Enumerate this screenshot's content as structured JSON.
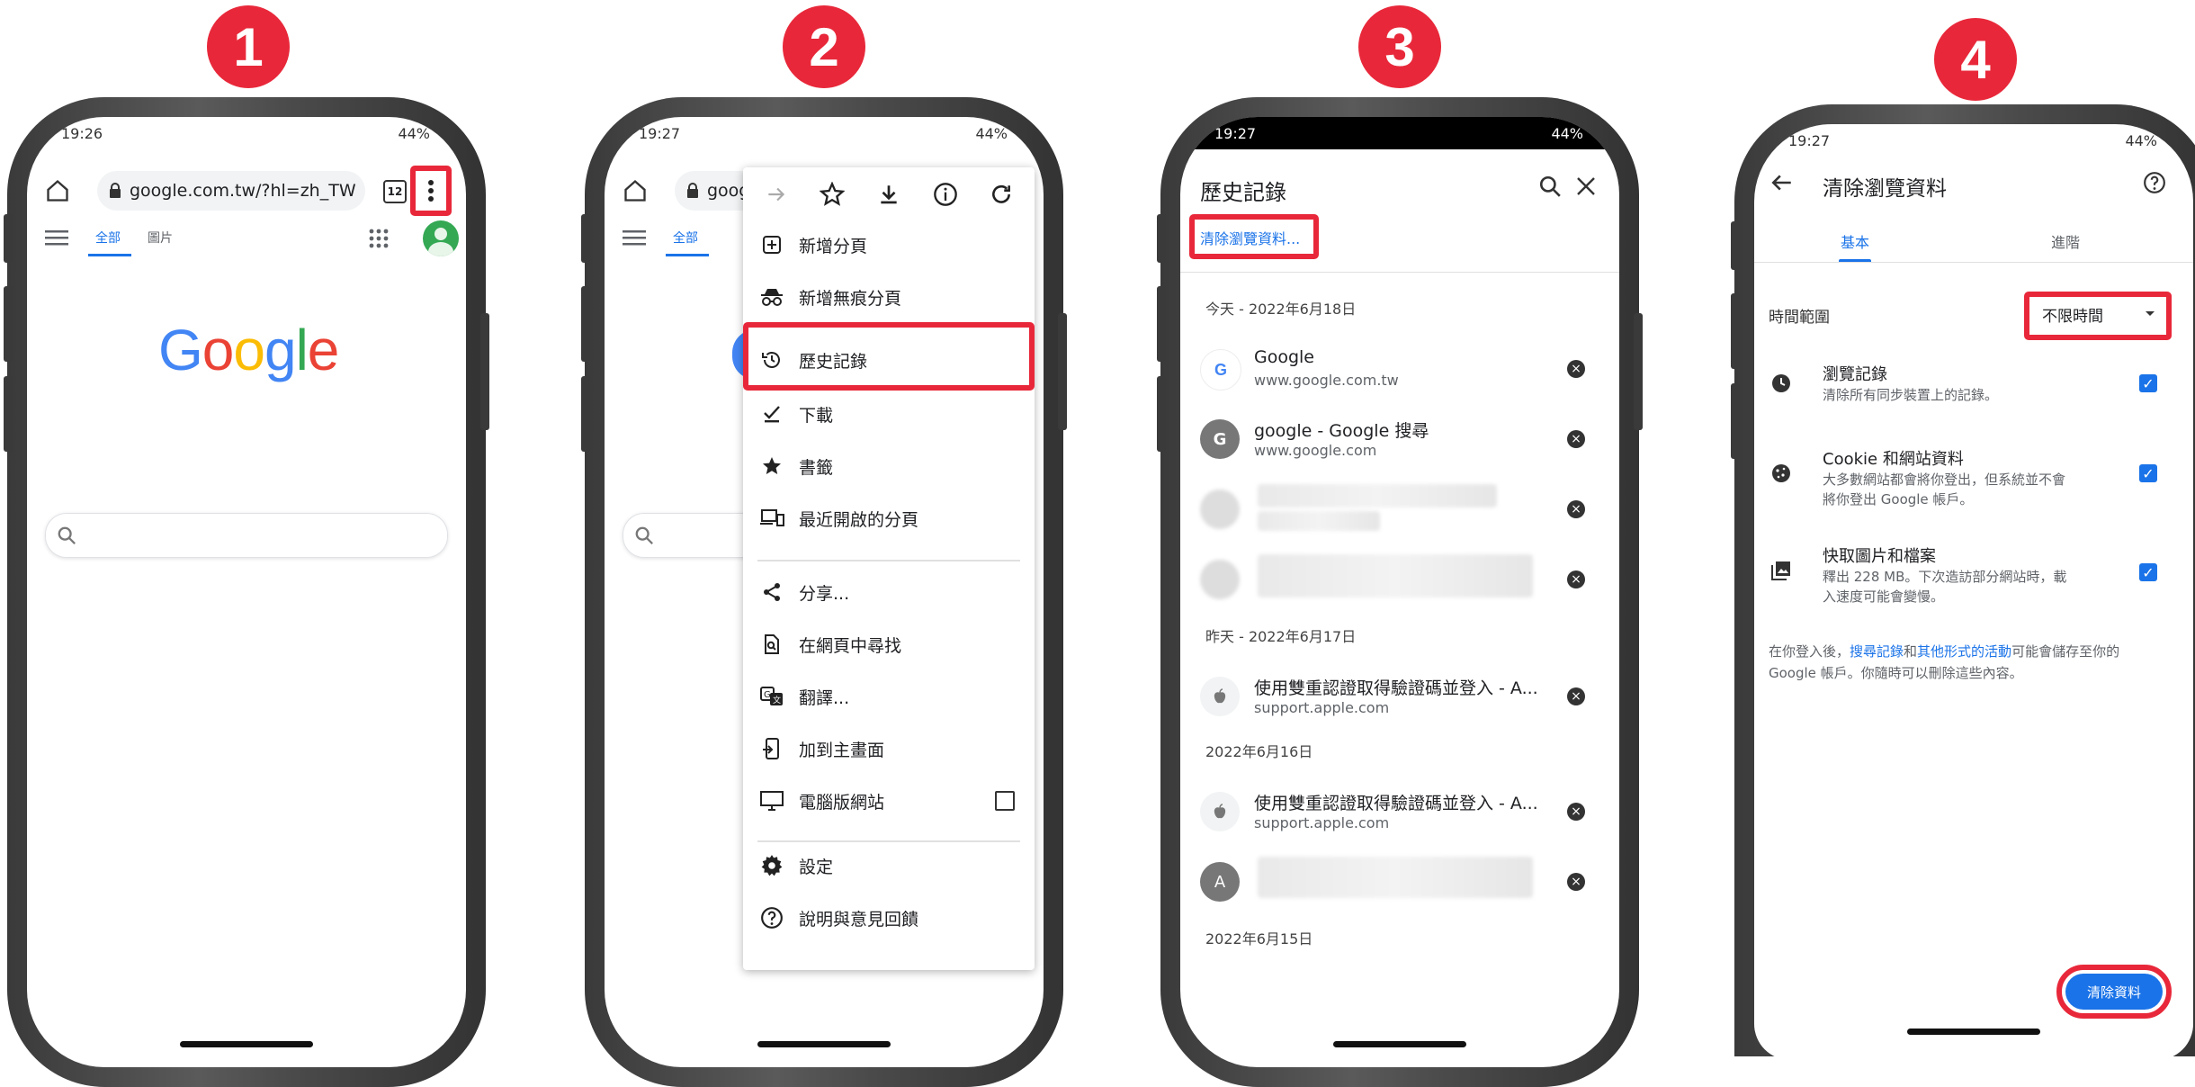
{
  "steps": [
    "1",
    "2",
    "3",
    "4"
  ],
  "status": {
    "p1_time": "19:26",
    "p2_time": "19:27",
    "p3_time": "19:27",
    "p4_time": "19:27",
    "battery": "44%"
  },
  "browser": {
    "url": "google.com.tw/?hl=zh_TW",
    "url_short": "goog",
    "tab_count": "12",
    "tab_all": "全部",
    "tab_images": "圖片",
    "logo": [
      "G",
      "o",
      "o",
      "g",
      "l",
      "e"
    ],
    "logo_colors": [
      "#4285F4",
      "#EA4335",
      "#FBBC05",
      "#4285F4",
      "#34A853",
      "#EA4335"
    ]
  },
  "menu": {
    "items": [
      {
        "label": "新增分頁",
        "icon": "new-tab-icon"
      },
      {
        "label": "新增無痕分頁",
        "icon": "incognito-icon"
      },
      {
        "label": "歷史記錄",
        "icon": "history-icon"
      },
      {
        "label": "下載",
        "icon": "download-check-icon"
      },
      {
        "label": "書籤",
        "icon": "star-icon"
      },
      {
        "label": "最近開啟的分頁",
        "icon": "devices-icon"
      },
      {
        "label": "分享...",
        "icon": "share-icon"
      },
      {
        "label": "在網頁中尋找",
        "icon": "find-in-page-icon"
      },
      {
        "label": "翻譯...",
        "icon": "translate-icon"
      },
      {
        "label": "加到主畫面",
        "icon": "add-to-home-icon"
      },
      {
        "label": "電腦版網站",
        "icon": "desktop-icon"
      },
      {
        "label": "設定",
        "icon": "settings-icon"
      },
      {
        "label": "說明與意見回饋",
        "icon": "help-icon"
      }
    ]
  },
  "history": {
    "title": "歷史記錄",
    "clear_link": "清除瀏覽資料...",
    "today": "今天 - 2022年6月18日",
    "yesterday": "昨天 - 2022年6月17日",
    "jun16": "2022年6月16日",
    "jun15": "2022年6月15日",
    "entries": [
      {
        "title": "Google",
        "url": "www.google.com.tw",
        "favicon": "G"
      },
      {
        "title": "google - Google 搜尋",
        "url": "www.google.com",
        "favicon": "G"
      },
      {
        "title": "使用雙重認證取得驗證碼並登入 - A...",
        "url": "support.apple.com",
        "favicon": ""
      },
      {
        "title": "使用雙重認證取得驗證碼並登入 - A...",
        "url": "support.apple.com",
        "favicon": ""
      },
      {
        "favicon": "A"
      }
    ]
  },
  "clear": {
    "title": "清除瀏覽資料",
    "tab_basic": "基本",
    "tab_advanced": "進階",
    "time_range_label": "時間範圍",
    "time_range_value": "不限時間",
    "options": [
      {
        "title": "瀏覽記錄",
        "desc1": "清除所有同步裝置上的記錄。",
        "desc2": "",
        "checked": true
      },
      {
        "title": "Cookie 和網站資料",
        "desc1": "大多數網站都會將你登出，但系統並不會",
        "desc2": "將你登出 Google 帳戶。",
        "checked": true
      },
      {
        "title": "快取圖片和檔案",
        "desc1": "釋出 228 MB。下次造訪部分網站時，載",
        "desc2": "入速度可能會變慢。",
        "checked": true
      }
    ],
    "footer_1": "在你登入後，",
    "footer_link1": "搜尋記錄",
    "footer_and": "和",
    "footer_link2": "其他形式的活動",
    "footer_2": "可能會儲存至你的",
    "footer_3": "Google 帳戶。你隨時可以刪除這些內容。",
    "clear_button": "清除資料"
  },
  "colors": {
    "accent_red": "#e8283a",
    "link_blue": "#1a73e8"
  }
}
